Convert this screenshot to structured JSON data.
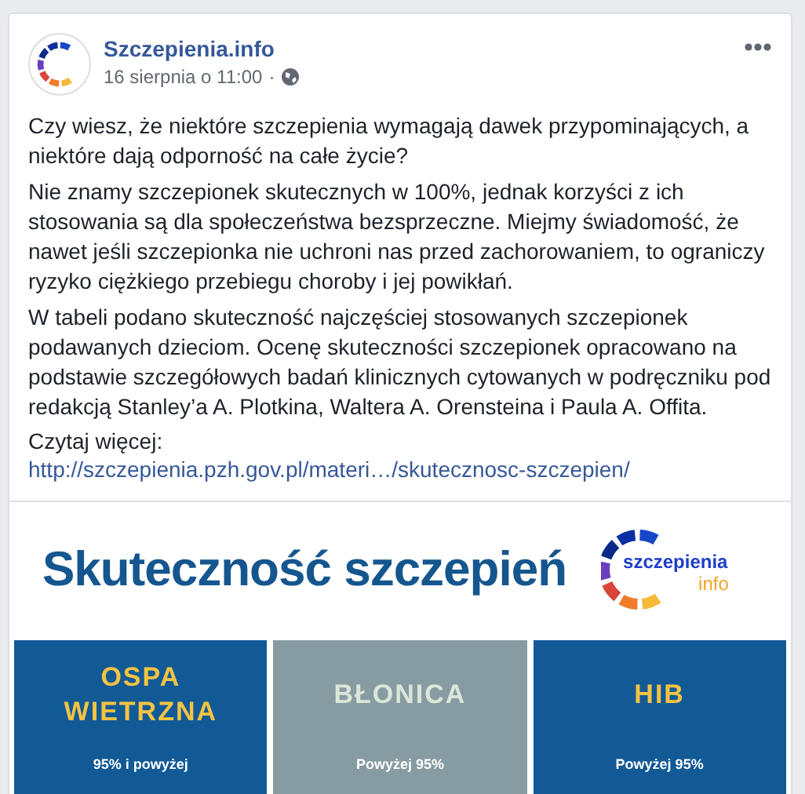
{
  "post": {
    "page_name": "Szczepienia.info",
    "date": "16 sierpnia o 11:00",
    "separator": "·",
    "paragraphs": [
      "Czy wiesz, że niektóre szczepienia wymagają dawek przypominających, a niektóre dają odporność na całe życie?",
      "Nie znamy szczepionek skutecznych w 100%, jednak korzyści z ich stosowania są dla społeczeństwa bezsprzeczne. Miejmy świadomość, że nawet jeśli szczepionka nie uchroni nas przed zachorowaniem, to ograniczy ryzyko ciężkiego przebiegu choroby i jej powikłań.",
      "W tabeli podano skuteczność najczęściej stosowanych szczepionek podawanych dzieciom. Ocenę skuteczności szczepionek opracowano na podstawie szczegółowych badań klinicznych cytowanych w podręczniku pod redakcją Stanley’a A. Plotkina, Waltera A. Orensteina i Paula A. Offita."
    ],
    "more_label": "Czytaj więcej:",
    "link": "http://szczepienia.pzh.gov.pl/materi…/skutecznosc-szczepien/"
  },
  "infographic": {
    "title": "Skuteczność szczepień",
    "logo_top": "szczepienia",
    "logo_bottom": "info",
    "tiles": [
      {
        "name": "OSPA\nWIETRZNA",
        "efficacy": "95% i powyżej",
        "color": "#125a96"
      },
      {
        "name": "BŁONICA",
        "efficacy": "Powyżej 95%",
        "color": "#879ca2"
      },
      {
        "name": "HIB",
        "efficacy": "Powyżej 95%",
        "color": "#125a96"
      }
    ]
  }
}
